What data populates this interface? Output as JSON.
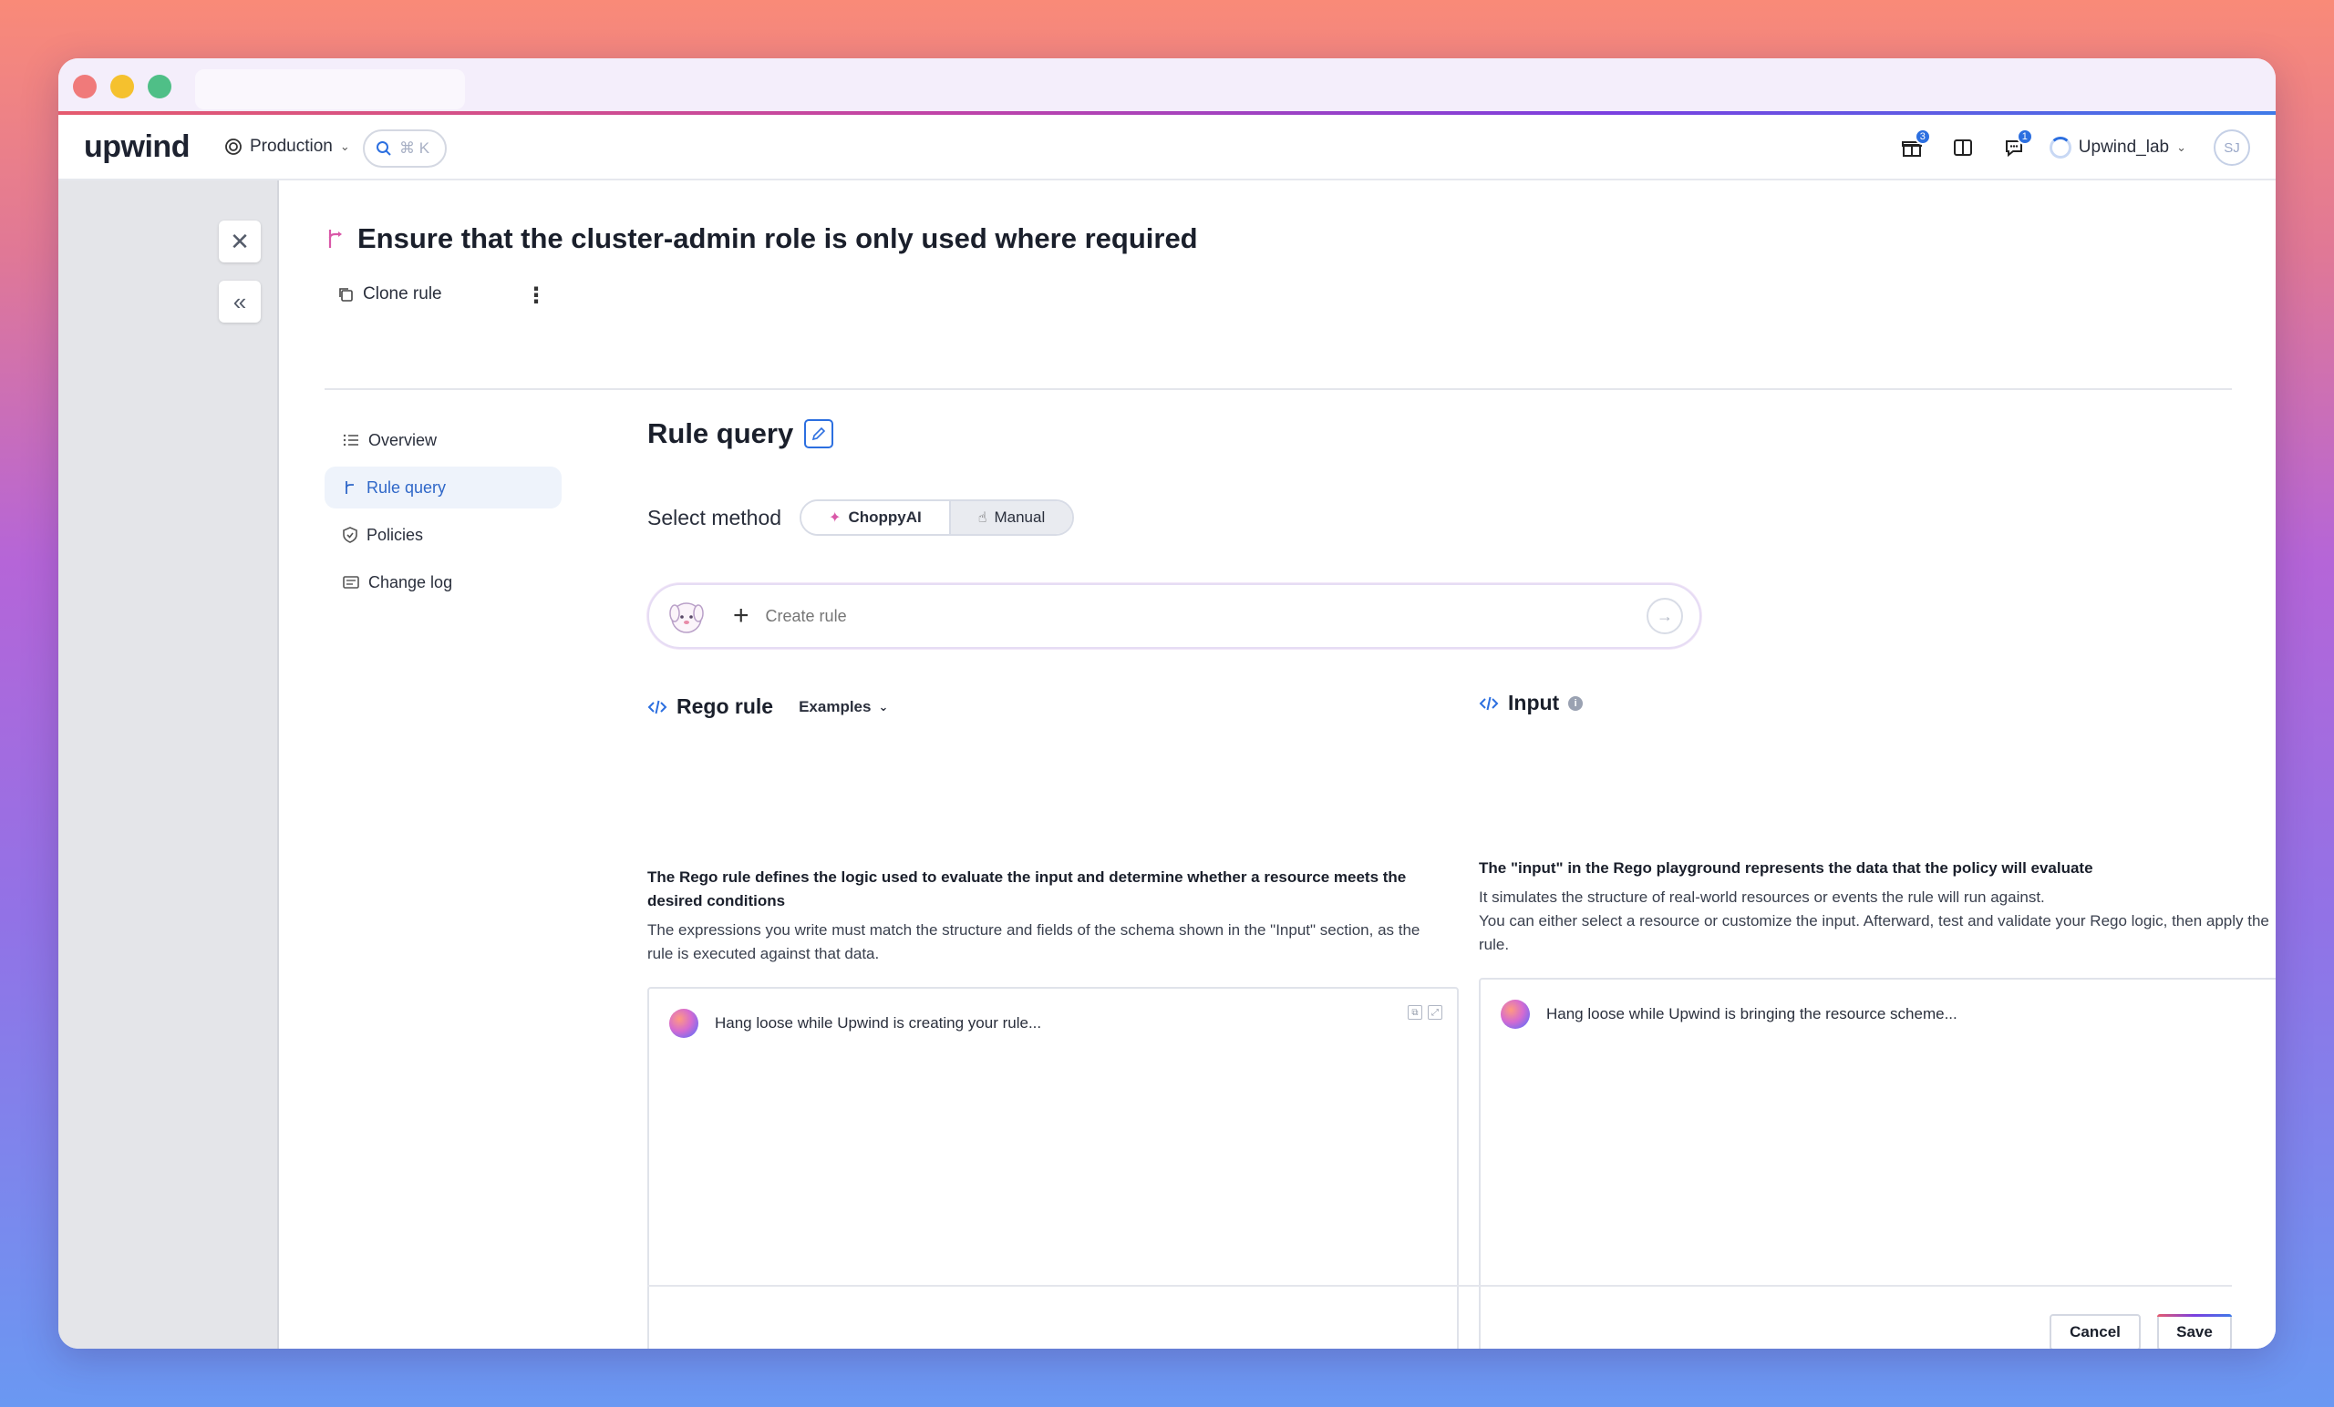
{
  "brand": {
    "logo": "upwind"
  },
  "topnav": {
    "environment": "Production",
    "search_hint": "⌘ K",
    "gift_badge": "3",
    "chat_badge": "1",
    "account": "Upwind_lab",
    "avatar": "SJ"
  },
  "page": {
    "title": "Ensure that the cluster-admin role is only used where required",
    "clone_label": "Clone rule"
  },
  "subnav": [
    {
      "label": "Overview",
      "icon": "list-icon"
    },
    {
      "label": "Rule query",
      "icon": "branch-icon",
      "active": true
    },
    {
      "label": "Policies",
      "icon": "shield-icon"
    },
    {
      "label": "Change log",
      "icon": "log-icon"
    }
  ],
  "rule_query": {
    "title": "Rule query",
    "select_method_label": "Select method",
    "methods": [
      "ChoppyAI",
      "Manual"
    ],
    "create_placeholder": "Create rule"
  },
  "rego": {
    "title": "Rego rule",
    "examples_label": "Examples",
    "desc_bold": "The Rego rule defines the logic used to evaluate the input and determine whether a resource meets the desired conditions",
    "desc": "The expressions you write must match the structure and fields of the schema shown in the \"Input\" section, as the rule is executed against that data.",
    "loading": "Hang loose while Upwind is creating your rule..."
  },
  "input": {
    "title": "Input",
    "desc_bold": "The \"input\" in the Rego playground represents the data that the policy will evaluate",
    "desc_line1": "It simulates the structure of real-world resources or events the rule will run against.",
    "desc_line2": "You can either select a resource or customize the input. Afterward, test and validate your Rego logic, then apply the rule.",
    "loading": "Hang loose while Upwind is bringing the resource scheme..."
  },
  "footer": {
    "cancel": "Cancel",
    "save": "Save"
  },
  "colors": {
    "accent": "#2c6fe0",
    "brand_purple": "#7b3fe4"
  }
}
